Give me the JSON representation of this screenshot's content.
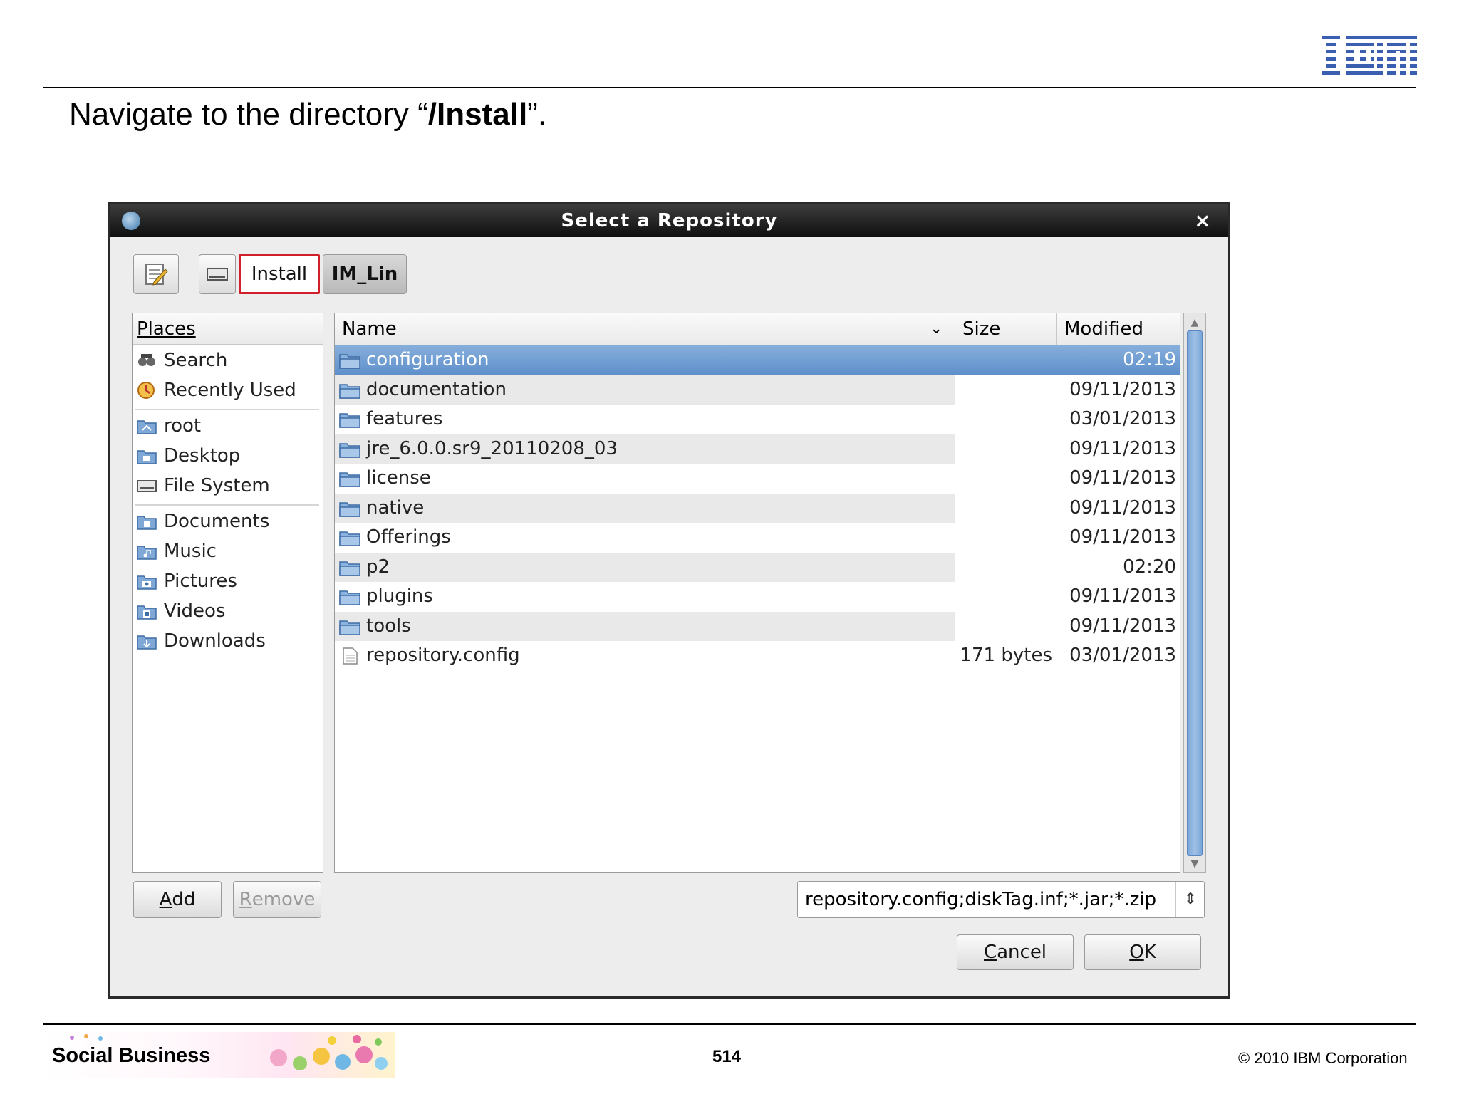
{
  "slide": {
    "title_prefix": "Navigate to the directory “",
    "title_bold": "/Install",
    "title_suffix": "”.",
    "footer_brand": "Social Business",
    "page_number": "514",
    "copyright": "© 2010 IBM Corporation",
    "logo": "IBM"
  },
  "dialog": {
    "title": "Select a Repository",
    "close_icon": "×",
    "path_bar": {
      "edit_icon": "edit-location-icon",
      "drive_icon": "drive-icon",
      "crumbs": [
        "Install",
        "IM_Lin"
      ],
      "highlight_color": "#d0202a"
    },
    "places": {
      "header": "Places",
      "items": [
        {
          "label": "Search",
          "icon": "search-icon"
        },
        {
          "label": "Recently Used",
          "icon": "recent-icon"
        },
        {
          "label": "root",
          "icon": "home-folder-icon"
        },
        {
          "label": "Desktop",
          "icon": "desktop-folder-icon"
        },
        {
          "label": "File System",
          "icon": "drive-icon"
        },
        {
          "label": "Documents",
          "icon": "documents-folder-icon"
        },
        {
          "label": "Music",
          "icon": "music-folder-icon"
        },
        {
          "label": "Pictures",
          "icon": "pictures-folder-icon"
        },
        {
          "label": "Videos",
          "icon": "videos-folder-icon"
        },
        {
          "label": "Downloads",
          "icon": "downloads-folder-icon"
        }
      ]
    },
    "files": {
      "columns": {
        "name": "Name",
        "size": "Size",
        "modified": "Modified"
      },
      "rows": [
        {
          "name": "configuration",
          "size": "",
          "modified": "02:19",
          "type": "folder",
          "selected": true
        },
        {
          "name": "documentation",
          "size": "",
          "modified": "09/11/2013",
          "type": "folder"
        },
        {
          "name": "features",
          "size": "",
          "modified": "03/01/2013",
          "type": "folder"
        },
        {
          "name": "jre_6.0.0.sr9_20110208_03",
          "size": "",
          "modified": "09/11/2013",
          "type": "folder"
        },
        {
          "name": "license",
          "size": "",
          "modified": "09/11/2013",
          "type": "folder"
        },
        {
          "name": "native",
          "size": "",
          "modified": "09/11/2013",
          "type": "folder"
        },
        {
          "name": "Offerings",
          "size": "",
          "modified": "09/11/2013",
          "type": "folder"
        },
        {
          "name": "p2",
          "size": "",
          "modified": "02:20",
          "type": "folder"
        },
        {
          "name": "plugins",
          "size": "",
          "modified": "09/11/2013",
          "type": "folder"
        },
        {
          "name": "tools",
          "size": "",
          "modified": "09/11/2013",
          "type": "folder"
        },
        {
          "name": "repository.config",
          "size": "171 bytes",
          "modified": "03/01/2013",
          "type": "file"
        }
      ],
      "selection_color": "#6f9dd3"
    },
    "buttons": {
      "add": {
        "mnemonic": "A",
        "rest": "dd"
      },
      "remove": {
        "mnemonic": "R",
        "rest": "emove"
      },
      "cancel": {
        "mnemonic": "C",
        "rest": "ancel"
      },
      "ok": {
        "mnemonic": "O",
        "rest": "K"
      }
    },
    "filter": {
      "value": "repository.config;diskTag.inf;*.jar;*.zip",
      "arrows": "⇕"
    }
  }
}
